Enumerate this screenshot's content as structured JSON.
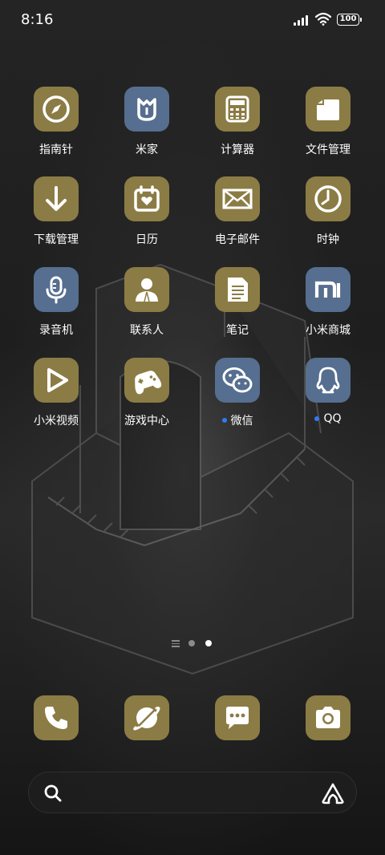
{
  "status_bar": {
    "time": "8:16",
    "battery": "100"
  },
  "apps": [
    {
      "label": "指南针",
      "icon": "compass-icon",
      "color": "#8b7c45"
    },
    {
      "label": "米家",
      "icon": "mijia-icon",
      "color": "#566e8f"
    },
    {
      "label": "计算器",
      "icon": "calculator-icon",
      "color": "#8b7c45"
    },
    {
      "label": "文件管理",
      "icon": "folder-icon",
      "color": "#8b7c45"
    },
    {
      "label": "下载管理",
      "icon": "download-icon",
      "color": "#8b7c45"
    },
    {
      "label": "日历",
      "icon": "calendar-icon",
      "color": "#8b7c45"
    },
    {
      "label": "电子邮件",
      "icon": "mail-icon",
      "color": "#8b7c45"
    },
    {
      "label": "时钟",
      "icon": "clock-icon",
      "color": "#8b7c45"
    },
    {
      "label": "录音机",
      "icon": "microphone-icon",
      "color": "#566e8f"
    },
    {
      "label": "联系人",
      "icon": "contacts-icon",
      "color": "#8b7c45"
    },
    {
      "label": "笔记",
      "icon": "notes-icon",
      "color": "#8b7c45"
    },
    {
      "label": "小米商城",
      "icon": "mi-store-icon",
      "color": "#566e8f"
    },
    {
      "label": "小米视频",
      "icon": "video-play-icon",
      "color": "#8b7c45"
    },
    {
      "label": "游戏中心",
      "icon": "gamepad-icon",
      "color": "#8b7c45"
    },
    {
      "label": "微信",
      "icon": "wechat-icon",
      "color": "#566e8f",
      "new_dot": true
    },
    {
      "label": "QQ",
      "icon": "qq-icon",
      "color": "#566e8f",
      "new_dot": true
    }
  ],
  "dock": [
    {
      "icon": "phone-icon"
    },
    {
      "icon": "browser-icon"
    },
    {
      "icon": "messages-icon"
    },
    {
      "icon": "camera-icon"
    }
  ],
  "page_indicator": {
    "pages": 2,
    "current": 2
  },
  "colors": {
    "gold": "#8b7c45",
    "blue": "#566e8f",
    "notification_dot": "#2f7bf6"
  }
}
